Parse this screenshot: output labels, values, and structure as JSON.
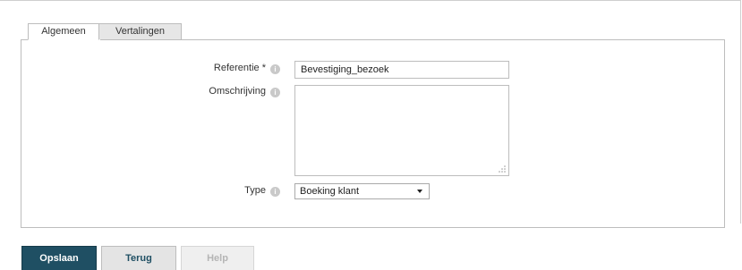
{
  "tabs": [
    {
      "label": "Algemeen",
      "active": true
    },
    {
      "label": "Vertalingen",
      "active": false
    }
  ],
  "form": {
    "referentie": {
      "label": "Referentie *",
      "value": "Bevestiging_bezoek"
    },
    "omschrijving": {
      "label": "Omschrijving",
      "value": ""
    },
    "type": {
      "label": "Type",
      "selected": "Boeking klant"
    },
    "info_icon_glyph": "i"
  },
  "buttons": {
    "save": "Opslaan",
    "back": "Terug",
    "help": "Help"
  },
  "colors": {
    "primary": "#1f4f63",
    "secondary_bg": "#e4e4e4",
    "disabled_text": "#b5b5b5"
  }
}
